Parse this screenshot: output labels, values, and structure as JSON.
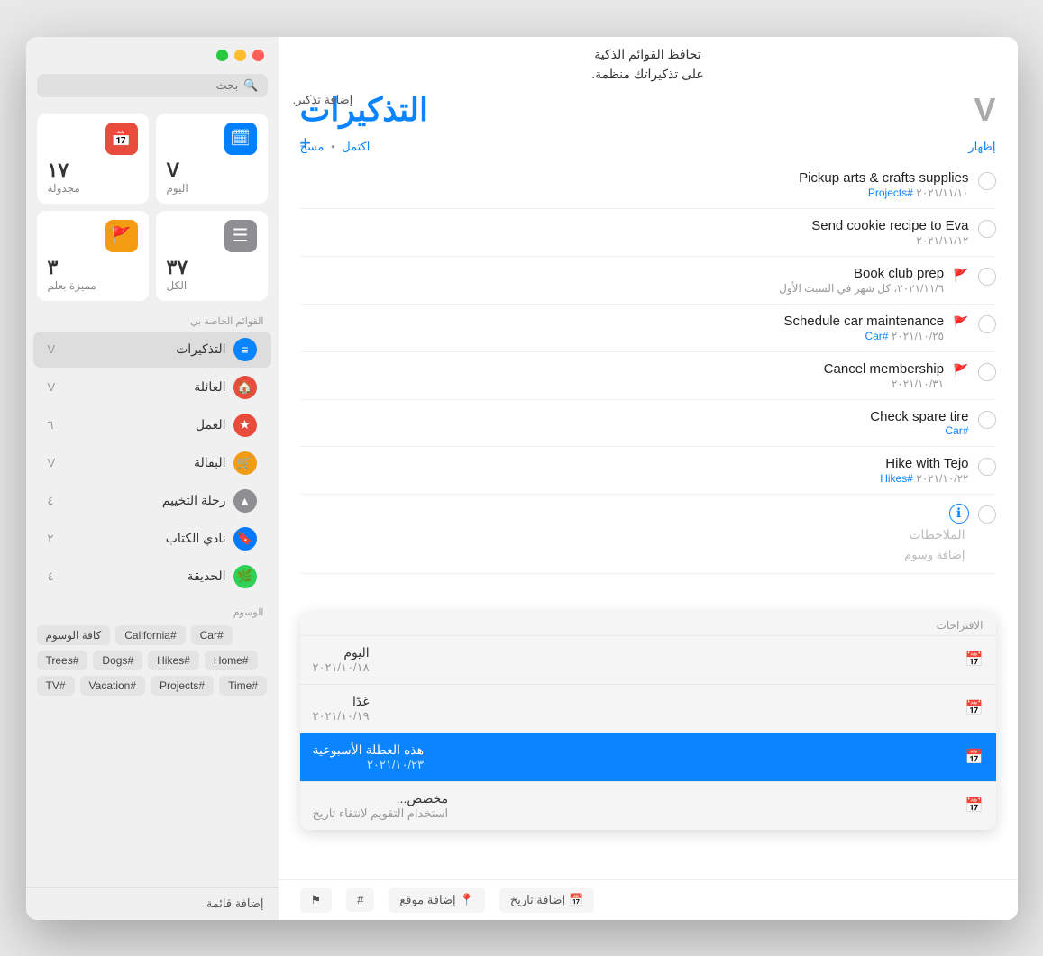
{
  "app": {
    "title": "التذكيرات"
  },
  "tooltip": {
    "line1": "تحافظ القوائم الذكية",
    "line2": "على تذكيراتك منظمة."
  },
  "add_reminder_label": "إضافة تذكير.",
  "sidebar": {
    "search_placeholder": "بحث",
    "smart_lists": [
      {
        "id": "today",
        "label": "اليوم",
        "count": "V",
        "icon": "🗓",
        "icon_class": "sl-today"
      },
      {
        "id": "scheduled",
        "label": "مجدولة",
        "count": "١٧",
        "icon": "📅",
        "icon_class": "sl-scheduled"
      },
      {
        "id": "all",
        "label": "الكل",
        "count": "٣٧",
        "icon": "⚫",
        "icon_class": "sl-all"
      },
      {
        "id": "flagged",
        "label": "مميزة بعلم",
        "count": "٣",
        "icon": "🚩",
        "icon_class": "sl-flagged"
      }
    ],
    "section_title": "القوائم الخاصة بي",
    "lists": [
      {
        "id": "reminders",
        "label": "التذكيرات",
        "count": "V",
        "color": "#0a84ff",
        "icon": "≡",
        "active": true
      },
      {
        "id": "family",
        "label": "العائلة",
        "count": "V",
        "color": "#e74c3c",
        "icon": "🏠"
      },
      {
        "id": "work",
        "label": "العمل",
        "count": "٦",
        "color": "#e74c3c",
        "icon": "★"
      },
      {
        "id": "groceries",
        "label": "البقالة",
        "count": "V",
        "color": "#f39c12",
        "icon": "🛒"
      },
      {
        "id": "camping",
        "label": "رحلة التخييم",
        "count": "٤",
        "color": "#8e8e93",
        "icon": "⚠"
      },
      {
        "id": "bookclub",
        "label": "نادي الكتاب",
        "count": "٢",
        "color": "#007aff",
        "icon": "🔖"
      },
      {
        "id": "garden",
        "label": "الحديقة",
        "count": "٤",
        "color": "#30d158",
        "icon": "🌿"
      }
    ],
    "tags_title": "الوسوم",
    "tags": [
      "#Car",
      "#California",
      "كافة الوسوم",
      "#Home",
      "#Hikes",
      "#Dogs",
      "#Trees",
      "#Time",
      "#Projects",
      "#Vacation",
      "#TV"
    ],
    "add_list_label": "إضافة قائمة"
  },
  "main": {
    "title": "التذكيرات",
    "count": "V",
    "toolbar_clear": "مسح",
    "toolbar_dot": "•",
    "toolbar_complete": "اكتمل",
    "toolbar_show": "إظهار",
    "reminders": [
      {
        "id": 1,
        "title": "Pickup arts & crafts supplies",
        "date": "٢٠٢١/١١/١٠",
        "tag": "#Projects",
        "flagged": false
      },
      {
        "id": 2,
        "title": "Send cookie recipe to Eva",
        "date": "٢٠٢١/١١/١٢",
        "tag": "",
        "flagged": false
      },
      {
        "id": 3,
        "title": "Book club prep",
        "date": "٢٠٢١/١١/٦، كل شهر في السبت الأول",
        "tag": "",
        "flagged": true
      },
      {
        "id": 4,
        "title": "Schedule car maintenance",
        "date": "٢٠٢١/١٠/٢٥",
        "tag": "#Car",
        "flagged": true
      },
      {
        "id": 5,
        "title": "Cancel membership",
        "date": "٢٠٢١/١٠/٣١",
        "tag": "",
        "flagged": true
      },
      {
        "id": 6,
        "title": "Check spare tire",
        "date": "",
        "tag": "#Car",
        "flagged": false
      },
      {
        "id": 7,
        "title": "Hike with Tejo",
        "date": "٢٠٢١/١٠/٢٢",
        "tag": "#Hikes",
        "flagged": false
      }
    ],
    "new_reminder_placeholder": "الملاحظات",
    "new_reminder_tags": "إضافة وسوم",
    "add_toolbar_items": [
      {
        "id": "add-date",
        "label": "إضافة تاريخ",
        "icon": "📅"
      },
      {
        "id": "add-location",
        "label": "إضافة موقع",
        "icon": "📍"
      },
      {
        "id": "hashtag",
        "label": "#",
        "icon": "#"
      },
      {
        "id": "flag",
        "label": "علم",
        "icon": "⚑"
      }
    ],
    "date_suggestions": {
      "title": "الاقتراحات",
      "options": [
        {
          "id": "today",
          "label": "اليوم",
          "date": "٢٠٢١/١٠/١٨",
          "selected": false
        },
        {
          "id": "tomorrow",
          "label": "غدًا",
          "date": "٢٠٢١/١٠/١٩",
          "selected": false
        },
        {
          "id": "this-weekend",
          "label": "هذه العطلة الأسبوعية",
          "date": "٢٠٢١/١٠/٢٣",
          "selected": true
        },
        {
          "id": "custom",
          "label": "مخصص...",
          "date": "استخدام التقويم لانتقاء تاريخ",
          "selected": false
        }
      ]
    }
  }
}
